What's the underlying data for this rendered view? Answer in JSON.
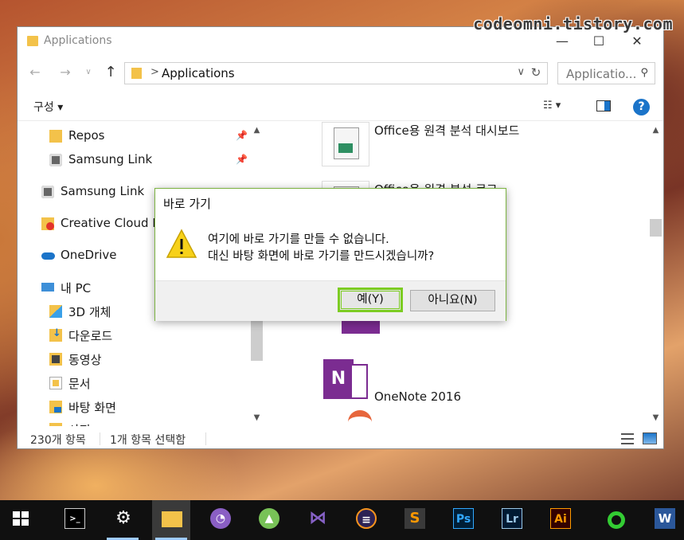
{
  "watermark": "codeomni.tistory.com",
  "window": {
    "title": "Applications",
    "controls": {
      "minimize": "—",
      "maximize": "☐",
      "close": "✕"
    }
  },
  "address": {
    "path_sep": ">",
    "path": "Applications",
    "search_placeholder": "Applicatio..."
  },
  "toolbar": {
    "organize": "구성 ▾"
  },
  "nav": {
    "items": [
      {
        "label": "Repos",
        "icon": "folder-icon",
        "pinned": true
      },
      {
        "label": "Samsung Link",
        "icon": "samsung-link-icon",
        "pinned": true
      },
      {
        "label": "Samsung Link",
        "icon": "samsung-link-icon"
      },
      {
        "label": "Creative Cloud Files",
        "icon": "creative-cloud-icon"
      },
      {
        "label": "OneDrive",
        "icon": "onedrive-icon"
      },
      {
        "label": "내 PC",
        "icon": "pc-icon"
      },
      {
        "label": "3D 개체",
        "icon": "3d-objects-icon"
      },
      {
        "label": "다운로드",
        "icon": "downloads-icon"
      },
      {
        "label": "동영상",
        "icon": "videos-icon"
      },
      {
        "label": "문서",
        "icon": "documents-icon"
      },
      {
        "label": "바탕 화면",
        "icon": "desktop-icon"
      },
      {
        "label": "사진",
        "icon": "pictures-icon"
      }
    ]
  },
  "files": [
    {
      "label": "Office용 원격 분석 대시보드",
      "icon": "spreadsheet-icon"
    },
    {
      "label": "Office용 원격 분석 로그",
      "icon": "spreadsheet-icon"
    },
    {
      "label": "OneNote 2016",
      "icon": "onenote-icon"
    }
  ],
  "status": {
    "count": "230개 항목",
    "selected": "1개 항목 선택함"
  },
  "dialog": {
    "title": "바로 가기",
    "message_line1": "여기에 바로 가기를 만들 수 없습니다.",
    "message_line2": "대신 바탕 화면에 바로 가기를 만드시겠습니까?",
    "yes": "예(Y)",
    "no": "아니요(N)"
  },
  "taskbar": {
    "items": [
      {
        "name": "start",
        "glyph": "",
        "color": "#ffffff"
      },
      {
        "name": "terminal",
        "glyph": ">_",
        "color": "#ffffff"
      },
      {
        "name": "settings",
        "glyph": "⚙",
        "color": "#ffffff"
      },
      {
        "name": "file-explorer",
        "glyph": "▬",
        "color": "#f3c24a",
        "active": true
      },
      {
        "name": "github-desktop",
        "glyph": "●",
        "color": "#8a5fc4"
      },
      {
        "name": "android-studio",
        "glyph": "◆",
        "color": "#78c257"
      },
      {
        "name": "visual-studio",
        "glyph": "◣",
        "color": "#8661c5"
      },
      {
        "name": "eclipse",
        "glyph": "◉",
        "color": "#2c2255"
      },
      {
        "name": "sublime-text",
        "glyph": "S",
        "color": "#ff9800"
      },
      {
        "name": "photoshop",
        "glyph": "Ps",
        "color": "#31a8ff"
      },
      {
        "name": "lightroom",
        "glyph": "Lr",
        "color": "#9cc8e8"
      },
      {
        "name": "illustrator",
        "glyph": "Ai",
        "color": "#ff9a00"
      },
      {
        "name": "green-app",
        "glyph": "◯",
        "color": "#33cc33"
      },
      {
        "name": "word",
        "glyph": "W",
        "color": "#2b579a"
      }
    ]
  }
}
